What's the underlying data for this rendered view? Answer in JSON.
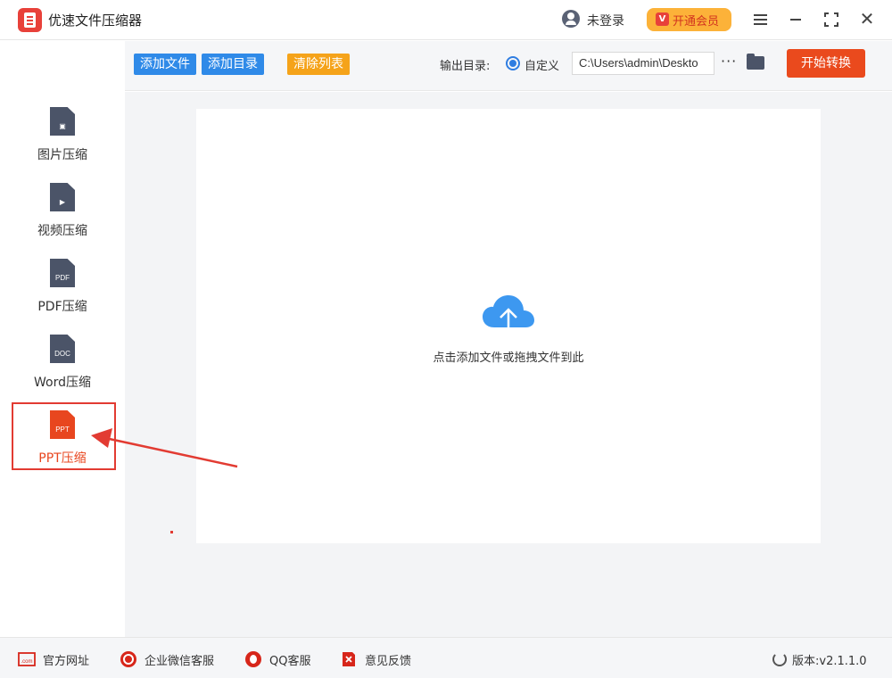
{
  "app": {
    "title": "优速文件压缩器",
    "user_status": "未登录",
    "vip_button": "开通会员",
    "vip_badge": "V"
  },
  "sidebar": {
    "items": [
      {
        "label": "图片压缩",
        "icon": "image-file-icon",
        "glyph": "▣"
      },
      {
        "label": "视频压缩",
        "icon": "video-file-icon",
        "glyph": "▶"
      },
      {
        "label": "PDF压缩",
        "icon": "pdf-file-icon",
        "glyph": "PDF"
      },
      {
        "label": "Word压缩",
        "icon": "doc-file-icon",
        "glyph": "DOC"
      },
      {
        "label": "PPT压缩",
        "icon": "ppt-file-icon",
        "glyph": "PPT"
      }
    ],
    "active_index": 4
  },
  "toolbar": {
    "add_file": "添加文件",
    "add_folder": "添加目录",
    "clear_list": "清除列表",
    "output_label": "输出目录:",
    "radio_label": "自定义",
    "output_path": "C:\\Users\\admin\\Deskto",
    "more": "···",
    "start": "开始转换"
  },
  "main": {
    "drop_text": "点击添加文件或拖拽文件到此"
  },
  "footer": {
    "website": "官方网址",
    "wechat": "企业微信客服",
    "qq": "QQ客服",
    "feedback": "意见反馈",
    "version": "版本:v2.1.1.0",
    "website_badge": ".com"
  },
  "colors": {
    "accent_blue": "#2f8ae8",
    "accent_orange": "#f5a31a",
    "start_red": "#ea4a1d",
    "active_red": "#e8461f",
    "highlight_red": "#e23b32"
  }
}
